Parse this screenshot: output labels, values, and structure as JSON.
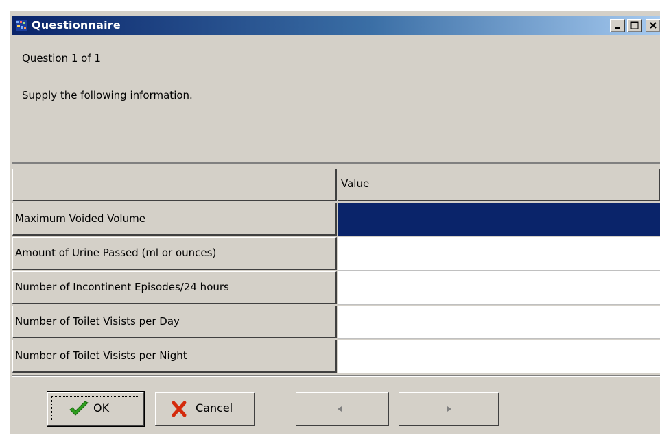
{
  "window": {
    "title": "Questionnaire"
  },
  "question": {
    "progress": "Question 1 of 1",
    "instruction": "Supply the following information."
  },
  "grid": {
    "column_header": "Value",
    "rows": [
      {
        "label": "Maximum Voided Volume",
        "value": "",
        "selected": true
      },
      {
        "label": "Amount of Urine Passed (ml or ounces)",
        "value": "",
        "selected": false
      },
      {
        "label": "Number of Incontinent Episodes/24 hours",
        "value": "",
        "selected": false
      },
      {
        "label": "Number of Toilet Visists per Day",
        "value": "",
        "selected": false
      },
      {
        "label": "Number of Toilet Visists per Night",
        "value": "",
        "selected": false
      }
    ]
  },
  "buttons": {
    "ok_label": "OK",
    "cancel_label": "Cancel",
    "prev_icon": "left-arrow-icon",
    "next_icon": "right-arrow-icon"
  },
  "colors": {
    "title_gradient_start": "#0a246a",
    "title_gradient_end": "#a6caf0",
    "selection": "#0a246a",
    "ok_check": "#2e9e1e",
    "cancel_x": "#d42a0c"
  }
}
